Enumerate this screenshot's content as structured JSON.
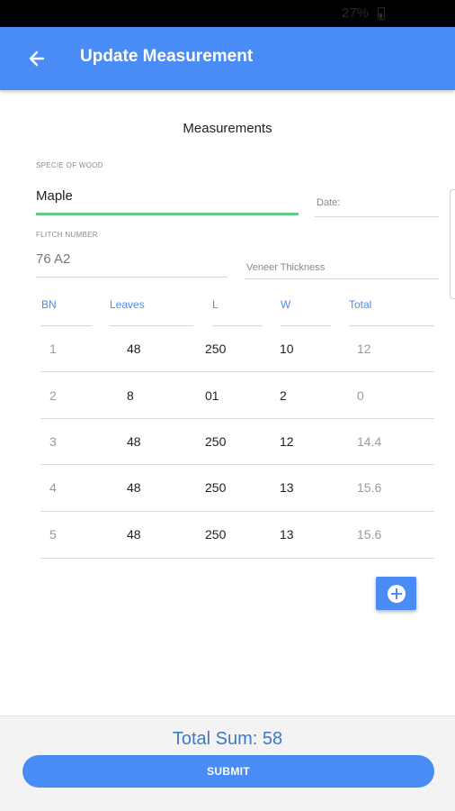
{
  "status_bar": {
    "battery": "27%"
  },
  "app_bar": {
    "title": "Update Measurement",
    "back_icon": "arrow-left-icon"
  },
  "form": {
    "section_title": "Measurements",
    "species": {
      "label": "SPECIE OF WOOD",
      "value": "Maple"
    },
    "date": {
      "placeholder": "Date:"
    },
    "flitch": {
      "label": "FLITCH NUMBER",
      "value": "76 A2"
    },
    "veneer": {
      "placeholder": "Veneer Thickness"
    }
  },
  "table": {
    "headers": [
      "BN",
      "Leaves",
      "L",
      "W",
      "Total"
    ],
    "rows": [
      [
        "1",
        "48",
        "250",
        "10",
        "12"
      ],
      [
        "2",
        "8",
        "01",
        "2",
        "0"
      ],
      [
        "3",
        "48",
        "250",
        "12",
        "14.4"
      ],
      [
        "4",
        "48",
        "250",
        "13",
        "15.6"
      ],
      [
        "5",
        "48",
        "250",
        "13",
        "15.6"
      ]
    ]
  },
  "add_row_icon": "plus-circle-icon",
  "footer": {
    "total_sum": "Total Sum: 58",
    "submit_label": "SUBMIT"
  }
}
